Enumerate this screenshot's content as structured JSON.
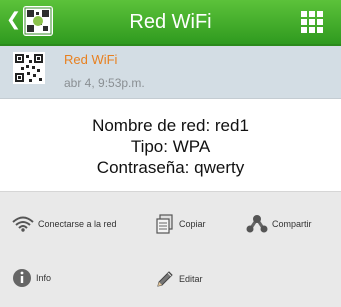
{
  "appbar": {
    "title": "Red WiFi",
    "back_icon": "chevron-left-icon",
    "app_icon": "qr-scanner-app-icon",
    "menu_icon": "grid-menu-icon",
    "bar_color": "#3fa82a"
  },
  "item": {
    "title": "Red WiFi",
    "date": "abr 4, 9:53p.m.",
    "icon": "qr-code-icon",
    "title_color": "#e8801f"
  },
  "content": {
    "line1": "Nombre de red: red1",
    "line2": "Tipo: WPA",
    "line3": "Contraseña: qwerty"
  },
  "actions": {
    "connect": {
      "label": "Conectarse a la red",
      "icon": "wifi-icon"
    },
    "copy": {
      "label": "Copiar",
      "icon": "copy-icon"
    },
    "share": {
      "label": "Compartir",
      "icon": "share-icon"
    },
    "info": {
      "label": "Info",
      "icon": "info-icon"
    },
    "edit": {
      "label": "Editar",
      "icon": "pencil-icon"
    }
  }
}
